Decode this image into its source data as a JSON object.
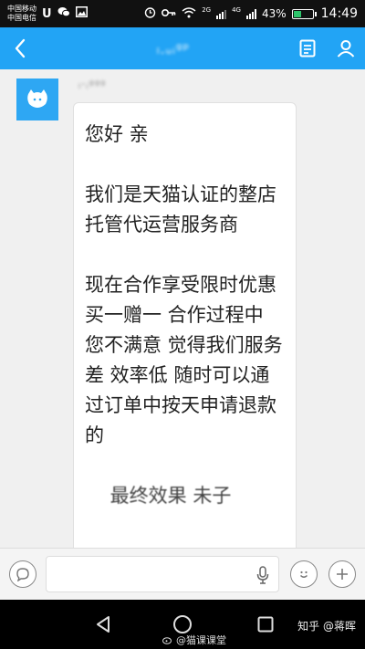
{
  "status_bar": {
    "carrier_1": "中国移动",
    "carrier_2": "中国电信",
    "net_1": "2G",
    "net_2": "4G",
    "battery_text": "43%",
    "battery_level": 0.43,
    "time": "14:49"
  },
  "header": {
    "title": "ₗ.ᵤᵢᵍᵖ",
    "back_icon": "chevron-left-icon",
    "detail_icon": "document-icon",
    "profile_icon": "person-icon",
    "color": "#22a4f5"
  },
  "message": {
    "sender": "ₗ·ᵢᵍᵍᵍ",
    "paragraphs": [
      "您好 亲",
      "我们是天猫认证的整店托管代运营服务商",
      "现在合作享受限时优惠 买一赠一 合作过程中 您不满意 觉得我们服务差 效率低 随时可以通过订单中按天申请退款的",
      "　 最终效果 未子"
    ]
  },
  "input_bar": {
    "placeholder": "",
    "value": "",
    "icons": [
      "voice-bubble-icon",
      "microphone-icon",
      "emoji-icon",
      "plus-icon"
    ]
  },
  "nav_bar": {
    "icons": [
      "back-triangle-icon",
      "home-circle-icon",
      "recents-square-icon"
    ]
  },
  "watermarks": {
    "weibo": "@猫课课堂",
    "zhihu": "知乎 @蒋晖"
  }
}
